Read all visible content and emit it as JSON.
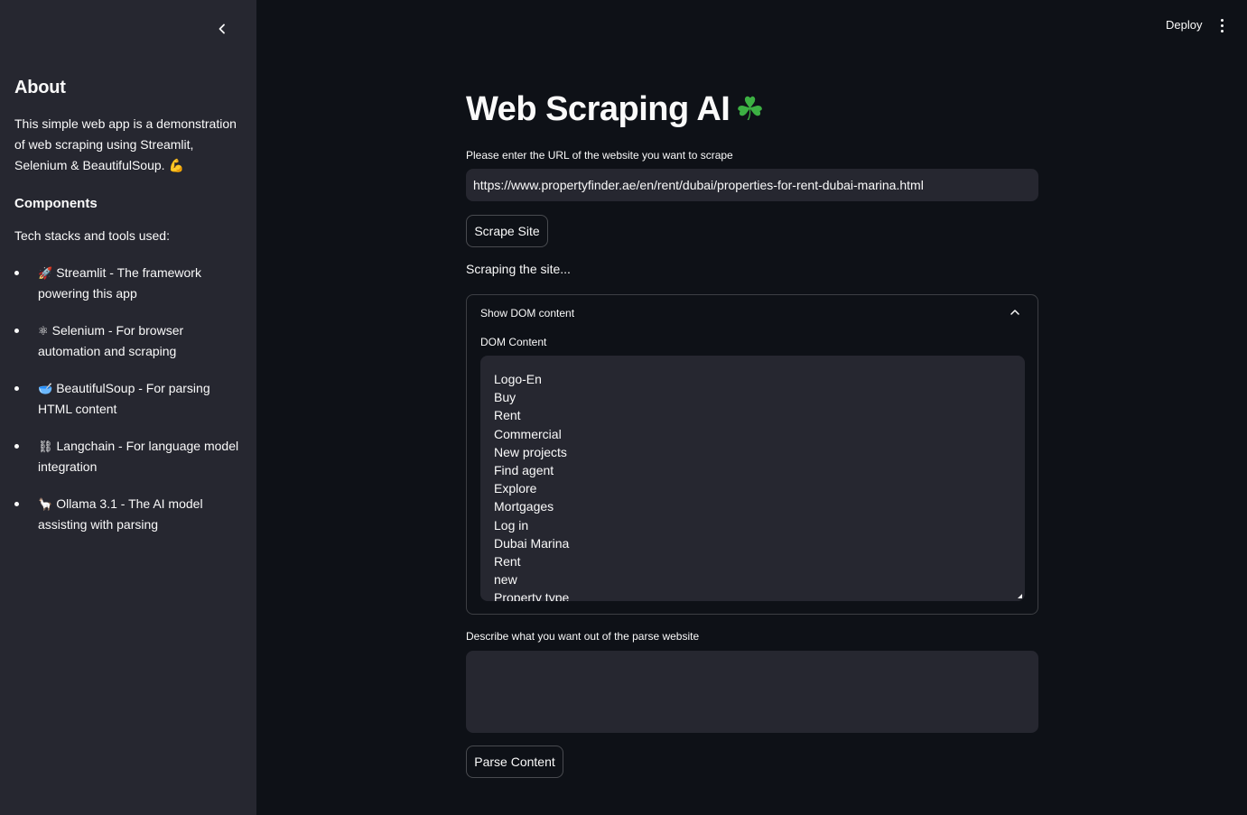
{
  "sidebar": {
    "collapse_icon": "chevron-left-icon",
    "about_title": "About",
    "about_text": "This simple web app is a demonstration of web scraping using Streamlit, Selenium & BeautifulSoup. 💪",
    "components_title": "Components",
    "tech_intro": "Tech stacks and tools used:",
    "items": [
      {
        "emoji": "🚀",
        "text": "Streamlit - The framework powering this app"
      },
      {
        "emoji": "⚛",
        "text": "Selenium - For browser automation and scraping"
      },
      {
        "emoji": "🥣",
        "text": "BeautifulSoup - For parsing HTML content"
      },
      {
        "emoji": "⛓",
        "text": "Langchain - For language model integration"
      },
      {
        "emoji": "🦙",
        "text": "Ollama 3.1 - The AI model assisting with parsing"
      }
    ]
  },
  "header": {
    "deploy_label": "Deploy",
    "menu_icon": "kebab-menu-icon"
  },
  "main": {
    "title": "Web Scraping AI",
    "title_emoji": "☘",
    "url_label": "Please enter the URL of the website you want to scrape",
    "url_value": "https://www.propertyfinder.ae/en/rent/dubai/properties-for-rent-dubai-marina.html",
    "scrape_button": "Scrape Site",
    "status_text": "Scraping the site...",
    "expander_title": "Show DOM content",
    "dom_label": "DOM Content",
    "dom_lines": [
      "Logo-En",
      "Buy",
      "Rent",
      "Commercial",
      "New projects",
      "Find agent",
      "Explore",
      "Mortgages",
      "Log in",
      "Dubai Marina",
      "Rent",
      "new",
      "Property type"
    ],
    "parse_label": "Describe what you want out of the parse website",
    "parse_value": "",
    "parse_button": "Parse Content"
  },
  "colors": {
    "background": "#0e1117",
    "sidebar": "#262730",
    "text": "#fafafa",
    "input_bg": "#262730"
  }
}
